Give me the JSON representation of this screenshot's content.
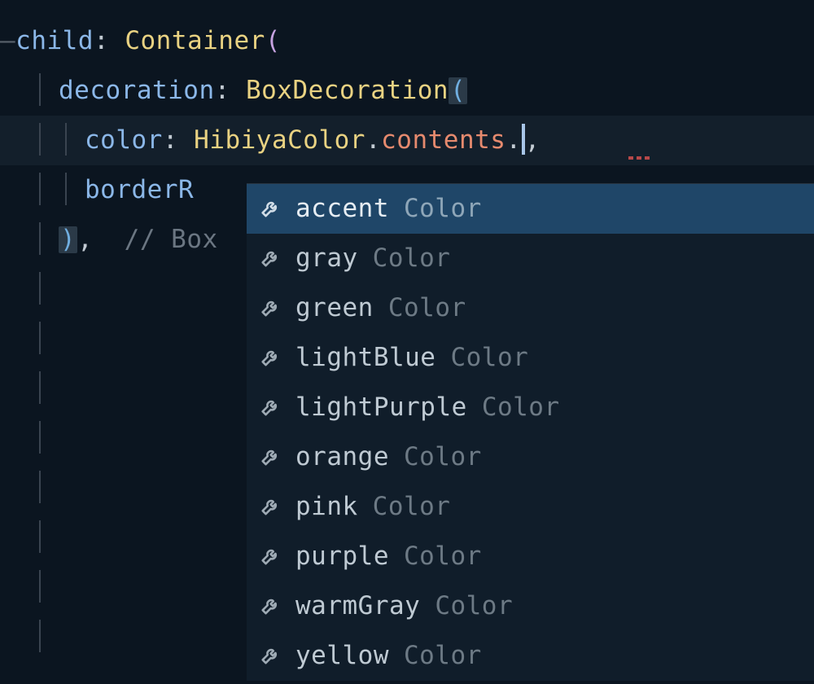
{
  "code": {
    "line1": {
      "dash": "—",
      "kw": "child",
      "colon": ": ",
      "type": "Container",
      "paren": "("
    },
    "line2": {
      "kw": "decoration",
      "colon": ": ",
      "type": "BoxDecoration",
      "paren": "("
    },
    "line3": {
      "kw": "color",
      "colon": ": ",
      "type": "HibiyaColor",
      "dot1": ".",
      "member": "contents",
      "dot2": ".",
      "tail": ","
    },
    "line4": {
      "kw": "borderR"
    },
    "line5": {
      "paren": ")",
      "comma": ",",
      "comment": "  // Box"
    }
  },
  "autocomplete": {
    "type_hint": "Color",
    "items": [
      {
        "label": "accent",
        "selected": true
      },
      {
        "label": "gray",
        "selected": false
      },
      {
        "label": "green",
        "selected": false
      },
      {
        "label": "lightBlue",
        "selected": false
      },
      {
        "label": "lightPurple",
        "selected": false
      },
      {
        "label": "orange",
        "selected": false
      },
      {
        "label": "pink",
        "selected": false
      },
      {
        "label": "purple",
        "selected": false
      },
      {
        "label": "warmGray",
        "selected": false
      },
      {
        "label": "yellow",
        "selected": false
      }
    ]
  }
}
